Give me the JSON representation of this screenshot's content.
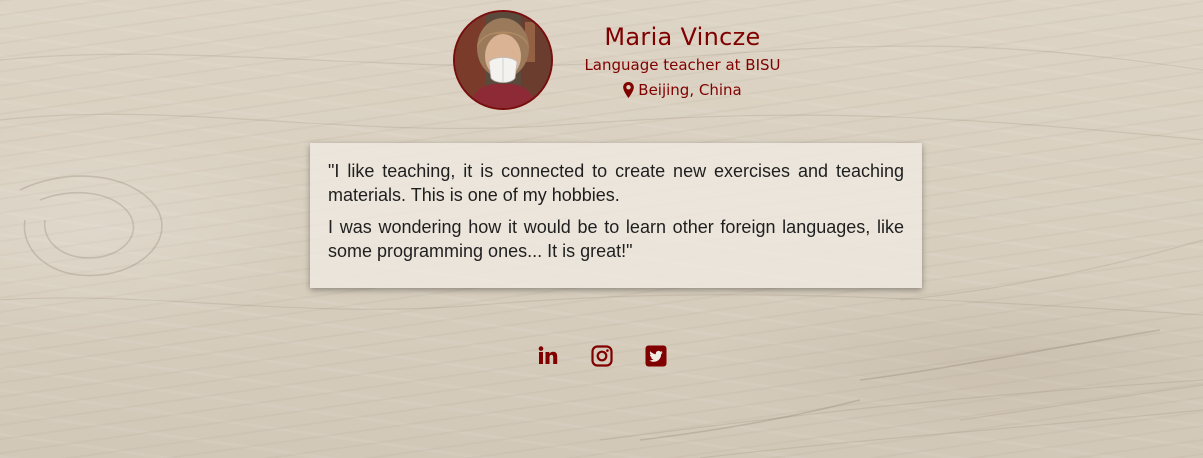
{
  "profile": {
    "name": "Maria Vincze",
    "role": "Language teacher at BISU",
    "location": "Beijing, China"
  },
  "quote": {
    "paragraph1": "\"I like teaching, it is connected to create new exercises and teaching materials. This is one of my hobbies.",
    "paragraph2": "I was wondering how it would be to learn other foreign languages, like some programming ones... It is great!\""
  },
  "social": {
    "items": [
      {
        "icon": "linkedin-icon"
      },
      {
        "icon": "instagram-icon"
      },
      {
        "icon": "twitter-icon"
      }
    ]
  },
  "colors": {
    "accent": "#800000",
    "background": "#d8cfbf",
    "card": "#f0ebe3"
  }
}
